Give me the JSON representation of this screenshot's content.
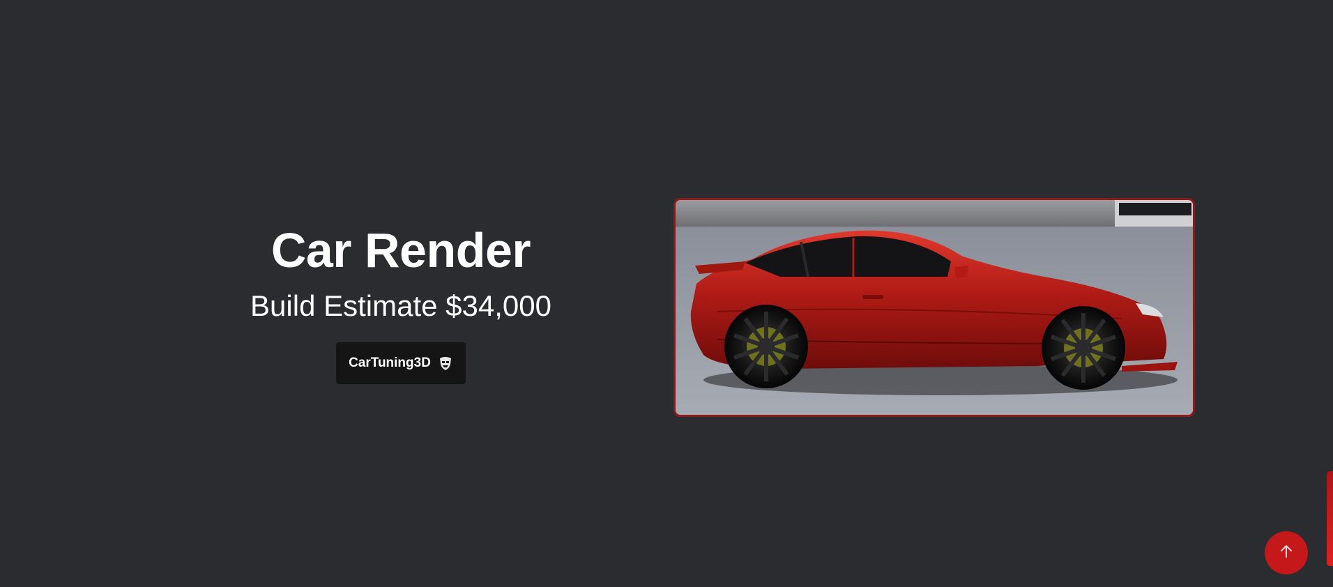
{
  "hero": {
    "title": "Car Render",
    "subtitle": "Build Estimate $34,000",
    "brand_button_label": "CarTuning3D",
    "brand_icon": "mask-icon"
  },
  "render_image": {
    "alt": "Red sports coupe side view render"
  },
  "controls": {
    "scroll_top_icon": "arrow-up-icon"
  },
  "colors": {
    "background": "#2a2c30",
    "accent": "#c4181a",
    "button_bg": "#151516",
    "frame_border": "#8d1a1a"
  }
}
